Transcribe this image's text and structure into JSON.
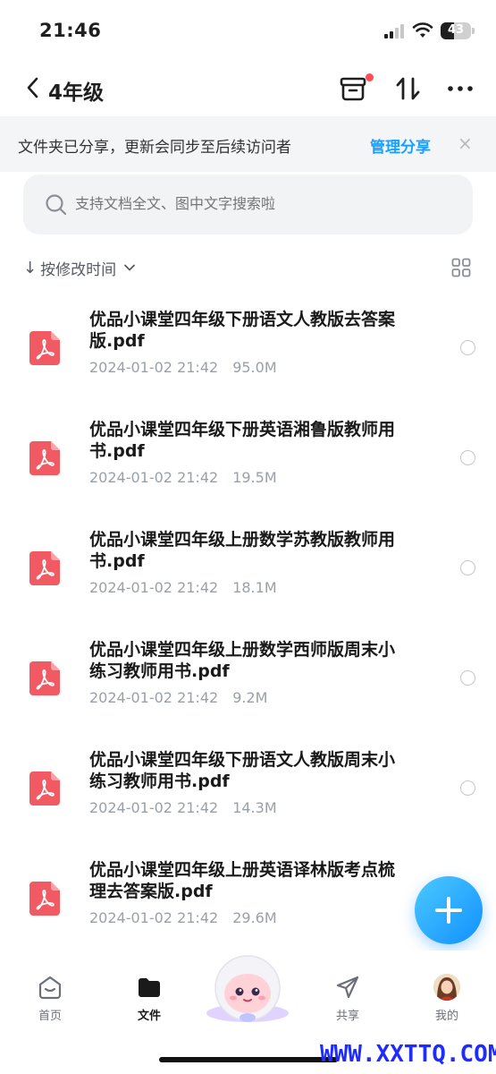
{
  "status_bar": {
    "time": "21:46",
    "battery": "43",
    "battery_level": 0.43
  },
  "header": {
    "title": "4年级"
  },
  "share_notice": {
    "text": "文件夹已分享，更新会同步至后续访问者",
    "action": "管理分享",
    "close": "×"
  },
  "search": {
    "placeholder": "支持文档全文、图中文字搜索啦"
  },
  "sort": {
    "arrow": "↓",
    "label": "按修改时间"
  },
  "files": [
    {
      "name": "优品小课堂四年级下册语文人教版去答案版.pdf",
      "date": "2024-01-02 21:42",
      "size": "95.0M"
    },
    {
      "name": "优品小课堂四年级下册英语湘鲁版教师用书.pdf",
      "date": "2024-01-02 21:42",
      "size": "19.5M"
    },
    {
      "name": "优品小课堂四年级上册数学苏教版教师用书.pdf",
      "date": "2024-01-02 21:42",
      "size": "18.1M"
    },
    {
      "name": "优品小课堂四年级上册数学西师版周末小练习教师用书.pdf",
      "date": "2024-01-02 21:42",
      "size": "9.2M"
    },
    {
      "name": "优品小课堂四年级下册语文人教版周末小练习教师用书.pdf",
      "date": "2024-01-02 21:42",
      "size": "14.3M"
    },
    {
      "name": "优品小课堂四年级上册英语译林版考点梳理去答案版.pdf",
      "date": "2024-01-02 21:42",
      "size": "29.6M"
    }
  ],
  "nav": {
    "home": "首页",
    "files": "文件",
    "share": "共享",
    "mine": "我的"
  },
  "watermark": "WWW.XXTTQ.COM",
  "colors": {
    "accent": "#1aa0ff",
    "pdf_red": "#f25a63",
    "fab": "#1190ff"
  }
}
